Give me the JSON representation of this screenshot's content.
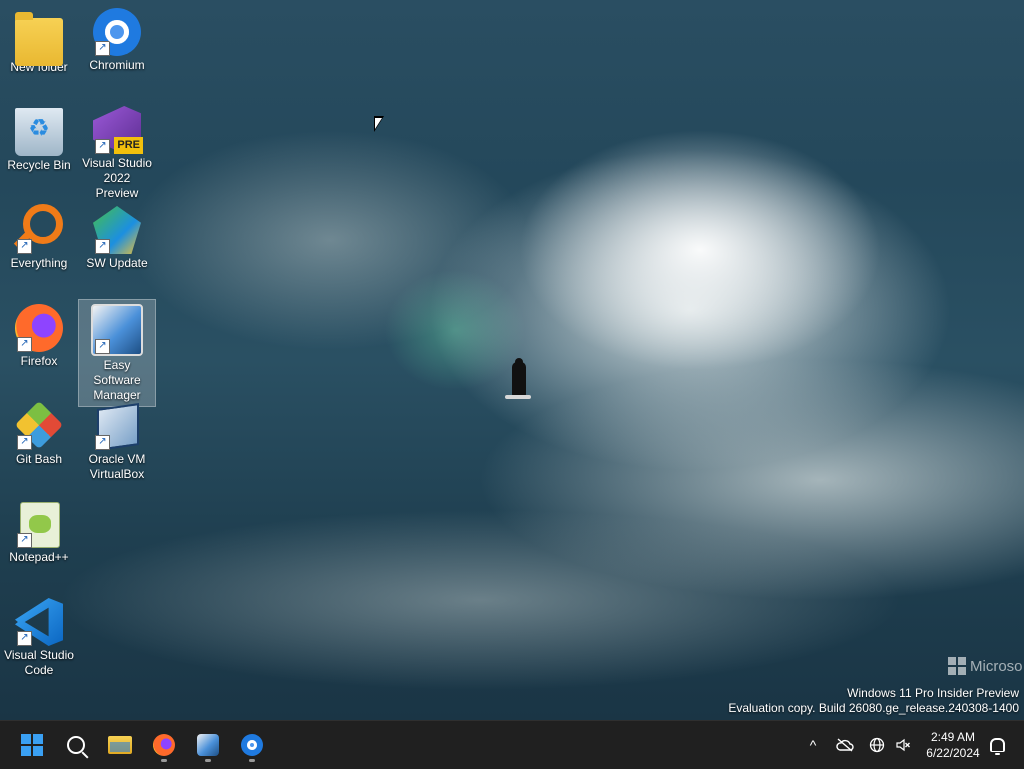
{
  "desktop": {
    "icons": [
      {
        "label": "New folder",
        "icon": "folder-icon"
      },
      {
        "label": "Chromium",
        "icon": "chromium-icon"
      },
      {
        "label": "Recycle Bin",
        "icon": "recycle-bin-icon"
      },
      {
        "label": "Visual Studio\n2022 Preview",
        "icon": "visual-studio-icon",
        "badge": "PRE"
      },
      {
        "label": "Everything",
        "icon": "everything-icon"
      },
      {
        "label": "SW Update",
        "icon": "sw-update-icon"
      },
      {
        "label": "Firefox",
        "icon": "firefox-icon"
      },
      {
        "label": "Easy Software\nManager",
        "icon": "easy-software-manager-icon",
        "selected": true
      },
      {
        "label": "Git Bash",
        "icon": "git-bash-icon"
      },
      {
        "label": "Oracle VM\nVirtualBox",
        "icon": "virtualbox-icon"
      },
      {
        "label": "Notepad++",
        "icon": "notepad-plus-plus-icon"
      },
      {
        "label": "Visual Studio\nCode",
        "icon": "vscode-icon"
      }
    ]
  },
  "watermark": {
    "brand": "Microso",
    "line1": "Windows 11 Pro Insider Preview",
    "line2": "Evaluation copy. Build 26080.ge_release.240308-1400"
  },
  "taskbar": {
    "apps": [
      "start-icon",
      "search-icon",
      "file-explorer-icon",
      "firefox-icon",
      "easy-software-manager-icon",
      "chromium-icon"
    ],
    "tray": {
      "chevron": "^",
      "time": "2:49 AM",
      "date": "6/22/2024"
    }
  }
}
